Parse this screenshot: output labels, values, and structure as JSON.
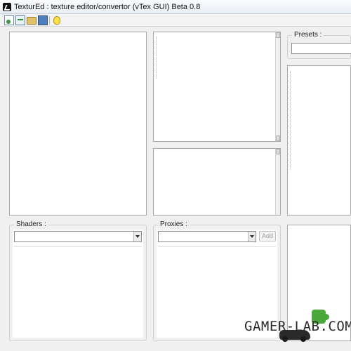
{
  "window": {
    "title": "TexturEd : texture editor/convertor (vTex GUI) Beta 0.8"
  },
  "toolbar": {
    "icons": [
      "new-file-icon",
      "open-file-icon",
      "folder-icon",
      "monitor-icon",
      "lightbulb-icon"
    ]
  },
  "presets": {
    "label": "Presets :",
    "value": ""
  },
  "shaders": {
    "label": "Shaders :",
    "value": ""
  },
  "proxies": {
    "label": "Proxies :",
    "value": "",
    "add_label": "Add"
  },
  "watermark": {
    "text": "GAMER-LAB.COM"
  },
  "colors": {
    "window_bg": "#f0f0f0",
    "panel_bg": "#ffffff",
    "border": "#a9a9a9",
    "watermark_accent": "#4aa83a"
  }
}
